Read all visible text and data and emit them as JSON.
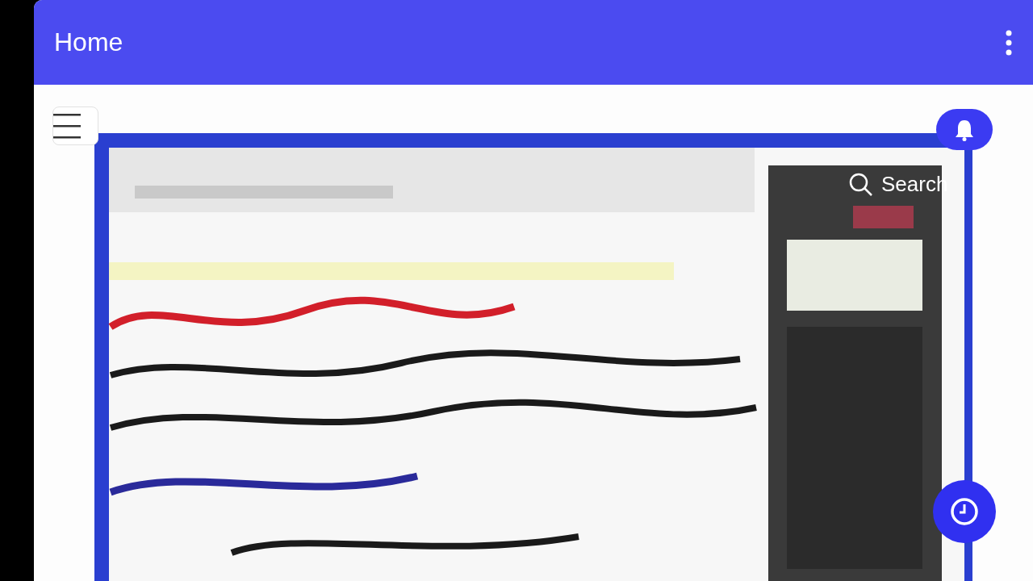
{
  "app_bar": {
    "title": "Home"
  },
  "search": {
    "label": "Search"
  }
}
